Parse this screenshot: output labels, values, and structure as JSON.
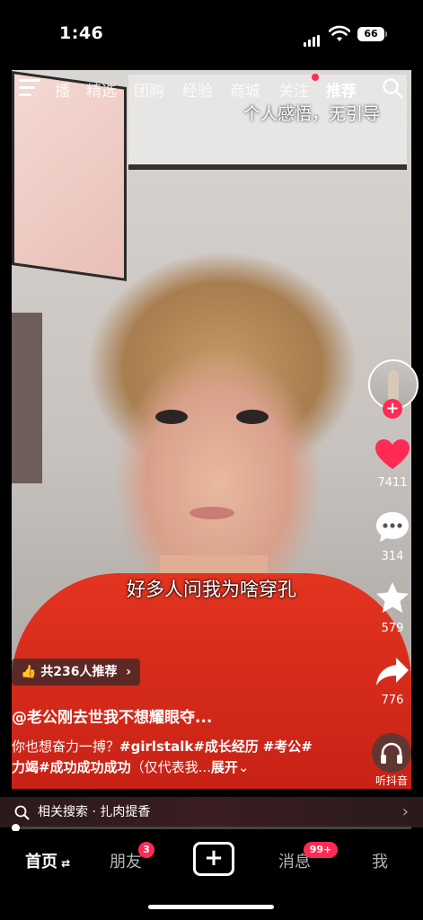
{
  "status_bar": {
    "time": "1:46",
    "battery": "66"
  },
  "top_nav": {
    "tabs": [
      "播",
      "精选",
      "团购",
      "经验",
      "商城",
      "关注",
      "推荐"
    ],
    "active_tab": "推荐",
    "follow_dot": true
  },
  "video": {
    "overlay_title": "个人感悟，无引导",
    "subtitle": "好多人问我为啥穿孔"
  },
  "actions": {
    "likes": "7411",
    "comments": "314",
    "favorites": "579",
    "shares": "776",
    "listen_label": "听抖音"
  },
  "recommend_chip": {
    "label": "共236人推荐"
  },
  "post": {
    "author": "@老公刚去世我不想耀眼夺...",
    "desc_prefix": "你也想奋力一搏？",
    "tag1": "#girlstalk",
    "tag2": "#成长经历",
    "tag3": "#考公",
    "tag4": "#力竭",
    "tag5": "#成功成功成功",
    "desc_suffix": "（仅代表我...",
    "expand": "展开"
  },
  "related_search": {
    "text": "相关搜索 · 扎肉提香"
  },
  "progress": {
    "fraction": 0.01
  },
  "bottom_nav": {
    "home": "首页",
    "friends": "朋友",
    "friends_badge": "3",
    "create": "+",
    "messages": "消息",
    "messages_badge": "99+",
    "me": "我"
  },
  "colors": {
    "accent": "#fe2c55"
  }
}
